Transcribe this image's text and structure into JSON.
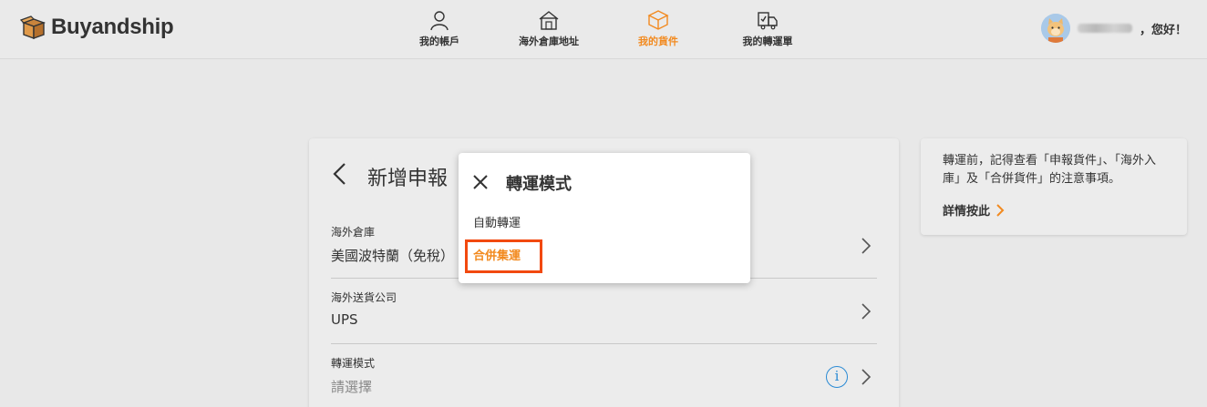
{
  "brand": {
    "name": "Buyandship"
  },
  "nav": [
    {
      "label": "我的帳戶",
      "icon": "user-icon",
      "active": false
    },
    {
      "label": "海外倉庫地址",
      "icon": "warehouse-icon",
      "active": false
    },
    {
      "label": "我的貨件",
      "icon": "package-icon",
      "active": true
    },
    {
      "label": "我的轉運單",
      "icon": "shipment-icon",
      "active": false
    }
  ],
  "user": {
    "greeting": "，您好！"
  },
  "form": {
    "title": "新增申報",
    "fields": [
      {
        "label": "海外倉庫",
        "value": "美國波特蘭（免稅）"
      },
      {
        "label": "海外送貨公司",
        "value": "UPS"
      },
      {
        "label": "轉運模式",
        "value": "請選擇"
      }
    ]
  },
  "info_icon": "i",
  "side": {
    "text": "轉運前，記得查看「申報貨件」、「海外入庫」及「合併貨件」的注意事項。",
    "link": "詳情按此"
  },
  "popup": {
    "title": "轉運模式",
    "options": [
      "自動轉運",
      "合併集運"
    ]
  },
  "colors": {
    "accent": "#f28a1f",
    "highlight_border": "#f2490f",
    "info": "#2a8ad4"
  }
}
